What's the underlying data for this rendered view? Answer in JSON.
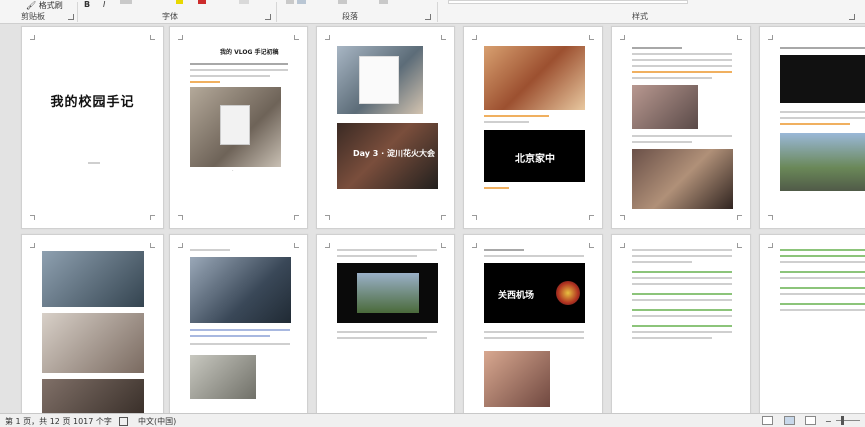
{
  "ribbon": {
    "format_painter": "格式刷",
    "groups": {
      "clipboard": "剪贴板",
      "font": "字体",
      "paragraph": "段落",
      "styles": "样式"
    }
  },
  "pages": {
    "p1": {
      "title": "我的校园手记"
    },
    "p2": {
      "title": "我的 VLOG 手记初稿"
    },
    "p3": {
      "card": "Day 3 · 淀川花火大会"
    },
    "p4": {
      "card": "北京家中"
    },
    "p8": {
      "card": "关西机场"
    }
  },
  "status": {
    "page": "第 1 页，共 12 页",
    "words": "1017 个字",
    "language": "中文(中国)"
  }
}
